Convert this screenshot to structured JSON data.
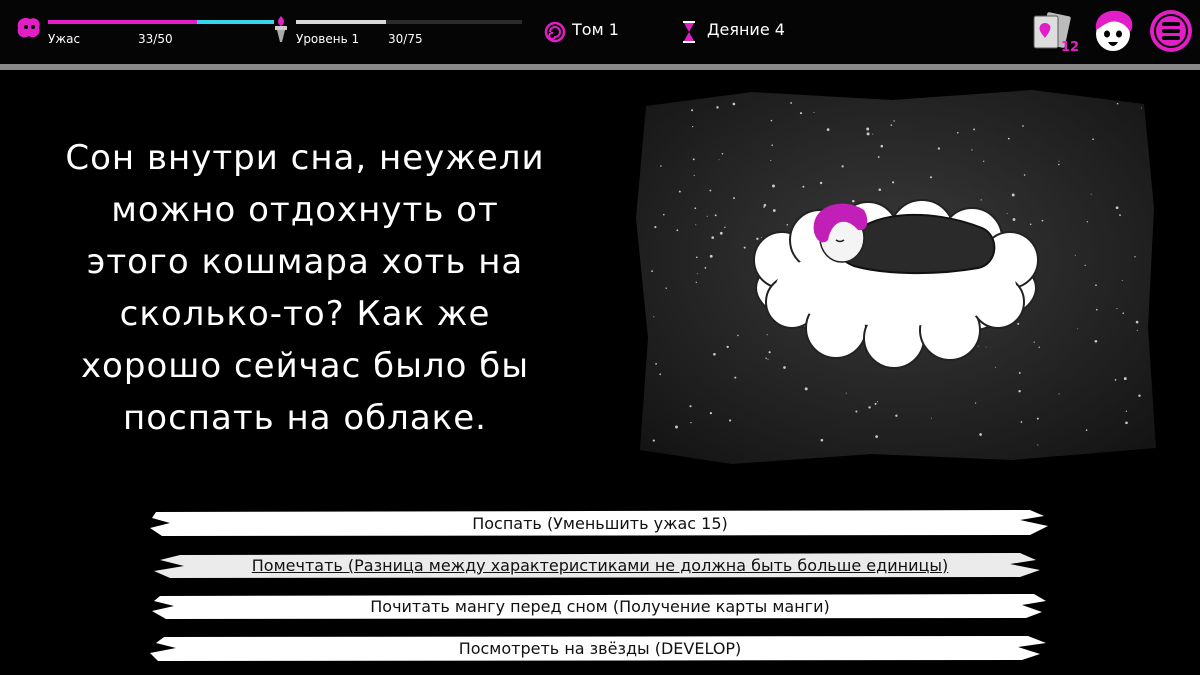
{
  "hud": {
    "horror": {
      "label": "Ужас",
      "value": "33/50",
      "fill": 0.66,
      "fill_color": "#e21fc6",
      "track_color": "#34d6e8"
    },
    "level": {
      "label": "Уровень 1",
      "value": "30/75",
      "fill": 0.4
    },
    "volume": {
      "label": "Том 1",
      "icon": "spiral-icon"
    },
    "deed": {
      "label": "Деяние 4",
      "icon": "hourglass-icon"
    },
    "cards": {
      "count": "12",
      "icon": "cards-icon"
    },
    "accent": "#e21fc6"
  },
  "narration": {
    "lines": [
      "Сон внутри сна, неужели",
      "можно отдохнуть от",
      "этого кошмара хоть на",
      "сколько-то? Как же",
      "хорошо сейчас было бы",
      "поспать на облаке."
    ]
  },
  "choices": [
    {
      "label": "Поспать (Уменьшить ужас 15)"
    },
    {
      "label": "Помечтать (Разница между характеристиками не должна быть больше единицы)"
    },
    {
      "label": "Почитать мангу перед сном (Получение карты манги)"
    },
    {
      "label": "Посмотреть на звёзды (DEVELOP)"
    }
  ]
}
